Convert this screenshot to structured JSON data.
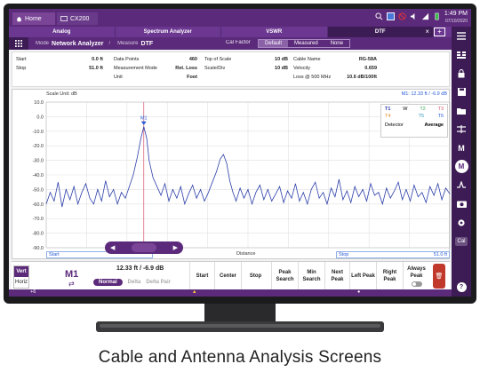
{
  "caption": "Cable and Antenna Analysis Screens",
  "topbar": {
    "home_label": "Home",
    "app_label": "CX200",
    "time": "1:49 PM",
    "date": "07/10/2020"
  },
  "tabs": [
    {
      "label": "Analog",
      "active": false
    },
    {
      "label": "Spectrum Analyzer",
      "active": false
    },
    {
      "label": "VSWR",
      "active": false
    },
    {
      "label": "DTF",
      "active": true
    }
  ],
  "add_tab": "+",
  "modebar": {
    "mode_label": "Mode",
    "mode_value": "Network Analyzer",
    "measure_label": "Measure",
    "measure_value": "DTF",
    "cal_factor_label": "Cal Factor",
    "cal_options": [
      "Default",
      "Measured",
      "None"
    ],
    "cal_selected": "Default"
  },
  "params": {
    "col1": [
      {
        "k": "Start",
        "v": "0.0 ft"
      },
      {
        "k": "Stop",
        "v": "51.0 ft"
      }
    ],
    "col2": [
      {
        "k": "Data Points",
        "v": "460"
      },
      {
        "k": "Measurement Mode",
        "v": "Ret. Loss"
      },
      {
        "k": "Unit",
        "v": "Foot"
      }
    ],
    "col3": [
      {
        "k": "Top of Scale",
        "v": "10 dB"
      },
      {
        "k": "Scale/Div",
        "v": "10 dB"
      }
    ],
    "col4": [
      {
        "k": "Cable Name",
        "v": "RG-58A"
      },
      {
        "k": "Velocity",
        "v": "0.659"
      },
      {
        "k": "Loss @ 500 MHz",
        "v": "10.6 dB/100ft"
      }
    ]
  },
  "plot": {
    "scale_unit": "Scale Unit: dB",
    "marker_readout": "M1: 12.33 ft / -6.9 dB",
    "marker_label": "M1",
    "x_start_label": "Start",
    "x_mid_label": "Distance",
    "x_stop_label": "Stop",
    "x_stop_value": "51.0 ft"
  },
  "legend": {
    "rows": [
      [
        "T1",
        "W",
        "T2",
        "T3"
      ],
      [
        "T4",
        "",
        "T5",
        "T6"
      ]
    ],
    "detector_label": "Detector",
    "detector_value": "Average"
  },
  "chart_data": {
    "type": "line",
    "x_range": [
      0,
      51
    ],
    "ylim": [
      -90,
      10
    ],
    "y_ticks": [
      "10.0",
      "0.0",
      "-10.0",
      "-20.0",
      "-30.0",
      "-40.0",
      "-50.0",
      "-60.0",
      "-70.0",
      "-80.0",
      "-90.0"
    ],
    "grid": true,
    "marker": {
      "x": 12.33,
      "y": -6.9
    },
    "points": [
      [
        0.0,
        -60
      ],
      [
        0.5,
        -52
      ],
      [
        1.0,
        -58
      ],
      [
        1.5,
        -45
      ],
      [
        2.0,
        -62
      ],
      [
        2.5,
        -50
      ],
      [
        3.0,
        -57
      ],
      [
        3.5,
        -48
      ],
      [
        4.0,
        -60
      ],
      [
        4.5,
        -52
      ],
      [
        5.0,
        -46
      ],
      [
        5.5,
        -56
      ],
      [
        6.0,
        -60
      ],
      [
        6.5,
        -50
      ],
      [
        7.0,
        -58
      ],
      [
        7.5,
        -44
      ],
      [
        8.0,
        -55
      ],
      [
        8.5,
        -50
      ],
      [
        9.0,
        -60
      ],
      [
        9.5,
        -52
      ],
      [
        10.0,
        -56
      ],
      [
        10.5,
        -48
      ],
      [
        11.0,
        -40
      ],
      [
        11.5,
        -28
      ],
      [
        12.0,
        -14
      ],
      [
        12.33,
        -6.9
      ],
      [
        12.7,
        -15
      ],
      [
        13.0,
        -30
      ],
      [
        13.5,
        -42
      ],
      [
        14.0,
        -48
      ],
      [
        14.5,
        -54
      ],
      [
        15.0,
        -46
      ],
      [
        15.5,
        -58
      ],
      [
        16.0,
        -50
      ],
      [
        16.5,
        -56
      ],
      [
        17.0,
        -48
      ],
      [
        17.5,
        -60
      ],
      [
        18.0,
        -53
      ],
      [
        18.5,
        -47
      ],
      [
        19.0,
        -56
      ],
      [
        19.5,
        -50
      ],
      [
        20.0,
        -58
      ],
      [
        20.5,
        -52
      ],
      [
        21.0,
        -45
      ],
      [
        21.5,
        -38
      ],
      [
        22.0,
        -29
      ],
      [
        22.4,
        -26
      ],
      [
        22.8,
        -32
      ],
      [
        23.2,
        -44
      ],
      [
        23.6,
        -52
      ],
      [
        24.0,
        -58
      ],
      [
        24.5,
        -49
      ],
      [
        25.0,
        -56
      ],
      [
        25.5,
        -50
      ],
      [
        26.0,
        -60
      ],
      [
        26.5,
        -52
      ],
      [
        27.0,
        -47
      ],
      [
        27.5,
        -57
      ],
      [
        28.0,
        -50
      ],
      [
        28.5,
        -58
      ],
      [
        29.0,
        -53
      ],
      [
        29.5,
        -48
      ],
      [
        30.0,
        -59
      ],
      [
        30.5,
        -51
      ],
      [
        31.0,
        -56
      ],
      [
        31.5,
        -46
      ],
      [
        32.0,
        -58
      ],
      [
        32.5,
        -52
      ],
      [
        33.0,
        -60
      ],
      [
        33.5,
        -50
      ],
      [
        34.0,
        -45
      ],
      [
        34.5,
        -56
      ],
      [
        35.0,
        -52
      ],
      [
        35.5,
        -60
      ],
      [
        36.0,
        -49
      ],
      [
        36.5,
        -55
      ],
      [
        37.0,
        -43
      ],
      [
        37.5,
        -57
      ],
      [
        38.0,
        -51
      ],
      [
        38.5,
        -59
      ],
      [
        39.0,
        -48
      ],
      [
        39.5,
        -55
      ],
      [
        40.0,
        -50
      ],
      [
        40.5,
        -58
      ],
      [
        41.0,
        -46
      ],
      [
        41.5,
        -54
      ],
      [
        42.0,
        -52
      ],
      [
        42.5,
        -60
      ],
      [
        43.0,
        -49
      ],
      [
        43.5,
        -56
      ],
      [
        44.0,
        -51
      ],
      [
        44.5,
        -45
      ],
      [
        45.0,
        -57
      ],
      [
        45.5,
        -50
      ],
      [
        46.0,
        -58
      ],
      [
        46.5,
        -47
      ],
      [
        47.0,
        -55
      ],
      [
        47.5,
        -52
      ],
      [
        48.0,
        -59
      ],
      [
        48.5,
        -48
      ],
      [
        49.0,
        -54
      ],
      [
        49.5,
        -46
      ],
      [
        50.0,
        -57
      ],
      [
        50.5,
        -49
      ],
      [
        51.0,
        -53
      ]
    ]
  },
  "softkeys": {
    "vert": "Vert",
    "horiz": "Horiz",
    "marker": "M1",
    "marker_value": "12.33 ft / -6.9 dB",
    "modes": [
      "Normal",
      "Delta",
      "Delta Pair"
    ],
    "buttons": [
      "Start",
      "Center",
      "Stop",
      "Peak Search",
      "Min Search",
      "Next Peak",
      "Left Peak",
      "Right Peak",
      "Always Peak"
    ]
  },
  "bottombar": {
    "left": "+6"
  },
  "colors": {
    "brand": "#5b2a7a",
    "trace": "#2b3ea8",
    "marker": "#2458d8",
    "marker_line": "#d9536d"
  }
}
